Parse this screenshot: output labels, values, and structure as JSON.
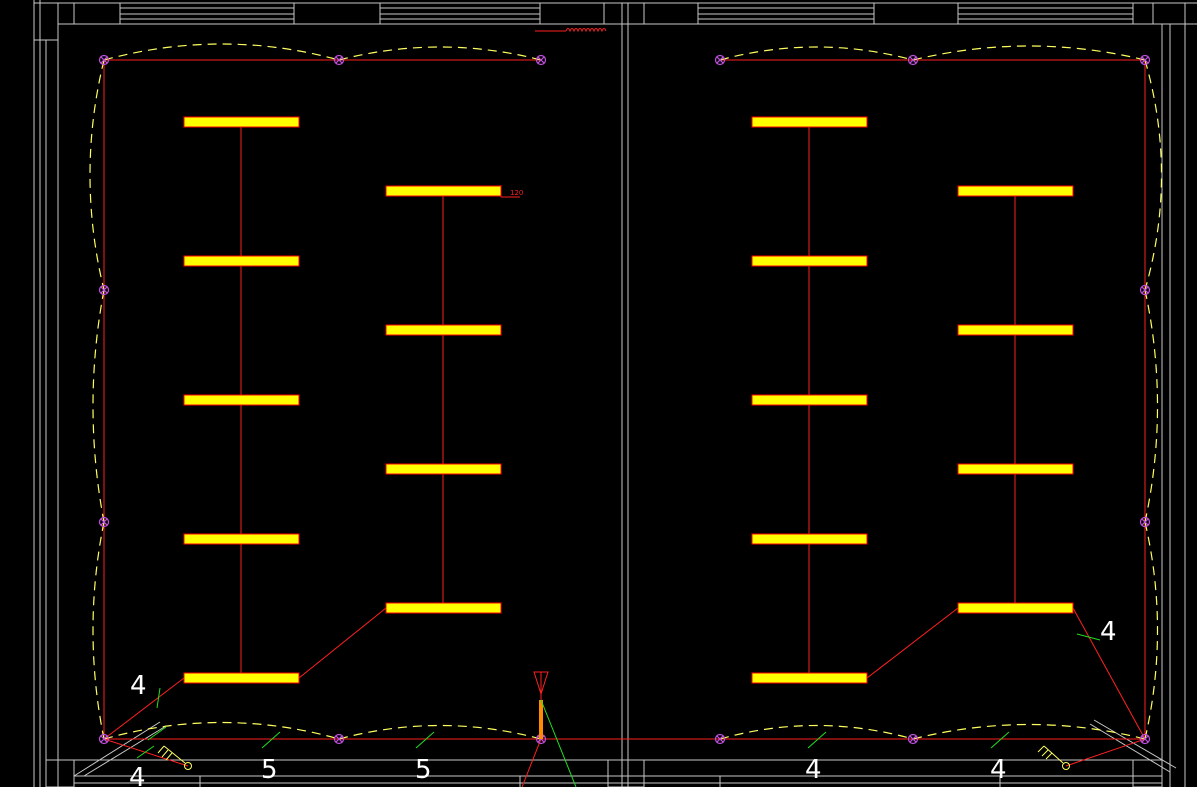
{
  "colors": {
    "background": "#000000",
    "wall": "#c8c8c8",
    "wire": "#ff2020",
    "lamp_fill": "#ffff00",
    "lamp_edge": "#ff0000",
    "arc": "#ffff60",
    "socket": "#c050e0",
    "label": "#ffffff",
    "tick": "#20e020",
    "riser": "#ff8c00"
  },
  "annotations": {
    "dim_label": "120",
    "wire_counts": [
      "4",
      "4",
      "5",
      "5",
      "4",
      "4",
      "4"
    ]
  },
  "symbols": {
    "lamp": "fluorescent-lamp-icon",
    "socket": "wall-socket-icon",
    "switch": "switch-icon",
    "panel": "distribution-panel-icon"
  }
}
